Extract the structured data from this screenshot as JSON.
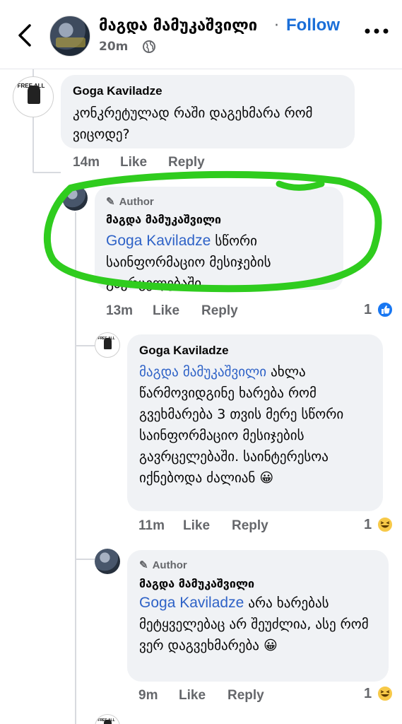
{
  "header": {
    "author": "მაგდა მამუკაშვილი",
    "separator": "·",
    "follow_label": "Follow",
    "time": "20m"
  },
  "comments": [
    {
      "name": "Goga Kaviladze",
      "badge": "",
      "mention": "",
      "text": "კონკრეტულად რაში დაგეხმარა რომ ვიცოდე?",
      "time": "14m",
      "like_label": "Like",
      "reply_label": "Reply",
      "reaction_count": ""
    },
    {
      "name": "მაგდა მამუკაშვილი",
      "badge": "Author",
      "mention": "Goga Kaviladze",
      "text": "სწორი საინფორმაციო მესიჯების გავრცელებაში.",
      "time": "13m",
      "like_label": "Like",
      "reply_label": "Reply",
      "reaction_count": "1",
      "reaction": "like"
    },
    {
      "name": "Goga Kaviladze",
      "badge": "",
      "mention": "მაგდა მამუკაშვილი",
      "text": "ახლა წარმოვიდგინე ხარება რომ გვეხმარება 3 თვის მერე სწორი საინფორმაციო მესიჯების გავრცელებაში. საინტერესოა იქნებოდა ძალიან 😀",
      "time": "11m",
      "like_label": "Like",
      "reply_label": "Reply",
      "reaction_count": "1",
      "reaction": "haha"
    },
    {
      "name": "მაგდა მამუკაშვილი",
      "badge": "Author",
      "mention": "Goga Kaviladze",
      "text": "არა ხარებას მეტყველებაც არ შეუძლია, ასე რომ ვერ დაგვეხმარება 😀",
      "time": "9m",
      "like_label": "Like",
      "reply_label": "Reply",
      "reaction_count": "1",
      "reaction": "haha"
    }
  ],
  "colors": {
    "accent": "#1a6ed8",
    "mention": "#2e62c7",
    "bubble": "#f0f2f5",
    "annotation": "#2fcc1e"
  },
  "icons": [
    "back-arrow-icon",
    "globe-icon",
    "more-options-icon",
    "pencil-icon",
    "like-reaction-icon",
    "haha-reaction-icon"
  ]
}
